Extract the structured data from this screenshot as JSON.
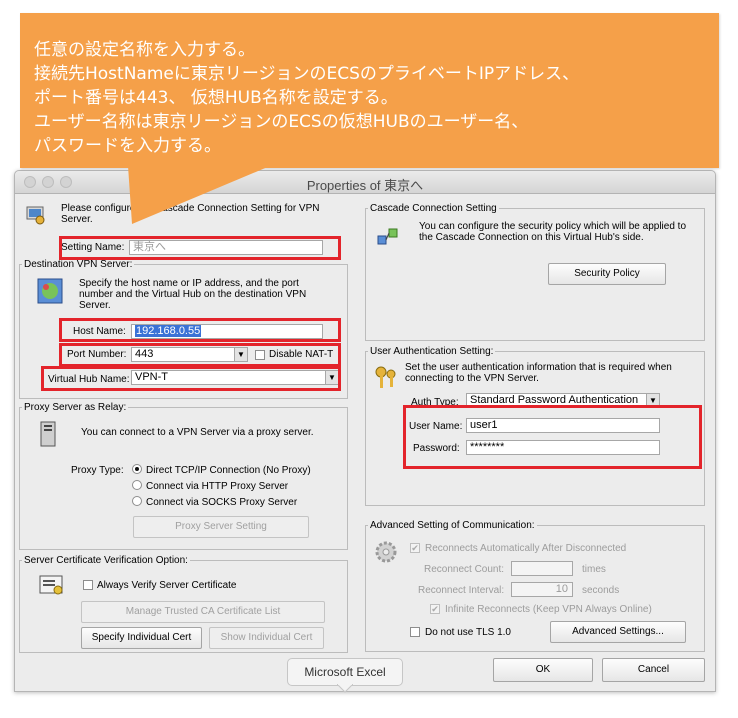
{
  "callout": {
    "lines": [
      "任意の設定名称を入力する。",
      "接続先HostNameに東京リージョンのECSのプライベートIPアドレス、",
      "ポート番号は443、 仮想HUB名称を設定する。",
      "ユーザー名称は東京リージョンのECSの仮想HUBのユーザー名、",
      "パスワードを入力する。"
    ],
    "color": "#f5a049"
  },
  "window": {
    "title": "Properties of 東京へ"
  },
  "intro": {
    "text": "Please configure the Cascade Connection Setting for VPN Server."
  },
  "setting_name": {
    "label": "Setting Name:",
    "value": "東京へ"
  },
  "destination": {
    "legend": "Destination VPN Server:",
    "description": "Specify the host name or IP address, and the port number and the Virtual Hub on the destination VPN Server.",
    "host_label": "Host Name:",
    "host_value": "192.168.0.55",
    "port_label": "Port Number:",
    "port_value": "443",
    "disable_nat_label": "Disable NAT-T",
    "hub_label": "Virtual Hub Name:",
    "hub_value": "VPN-T"
  },
  "proxy": {
    "legend": "Proxy Server as Relay:",
    "description": "You can connect to a VPN Server via a proxy server.",
    "type_label": "Proxy Type:",
    "options": [
      "Direct TCP/IP Connection (No Proxy)",
      "Connect via HTTP Proxy Server",
      "Connect via SOCKS Proxy Server"
    ],
    "setting_button": "Proxy Server Setting"
  },
  "cert": {
    "legend": "Server Certificate Verification Option:",
    "always_verify": "Always Verify Server Certificate",
    "manage_button": "Manage Trusted CA Certificate List",
    "specify_button": "Specify Individual Cert",
    "show_button": "Show Individual Cert"
  },
  "cascade": {
    "legend": "Cascade Connection Setting",
    "description": "You can configure the security policy which will be applied to the Cascade Connection on this Virtual Hub's side.",
    "policy_button": "Security Policy"
  },
  "auth": {
    "legend": "User Authentication Setting:",
    "description": "Set the user authentication information that is required when connecting to the VPN Server.",
    "type_label": "Auth Type:",
    "type_value": "Standard Password Authentication",
    "user_label": "User Name:",
    "user_value": "user1",
    "password_label": "Password:",
    "password_value": "********"
  },
  "advanced": {
    "legend": "Advanced Setting of Communication:",
    "reconnect_auto": "Reconnects Automatically After Disconnected",
    "reconnect_count_label": "Reconnect Count:",
    "reconnect_count_unit": "times",
    "reconnect_interval_label": "Reconnect Interval:",
    "reconnect_interval_value": "10",
    "reconnect_interval_unit": "seconds",
    "infinite": "Infinite Reconnects (Keep VPN Always Online)",
    "no_tls": "Do not use TLS 1.0",
    "advanced_button": "Advanced Settings..."
  },
  "buttons": {
    "ok": "OK",
    "cancel": "Cancel"
  },
  "tooltip": "Microsoft Excel"
}
